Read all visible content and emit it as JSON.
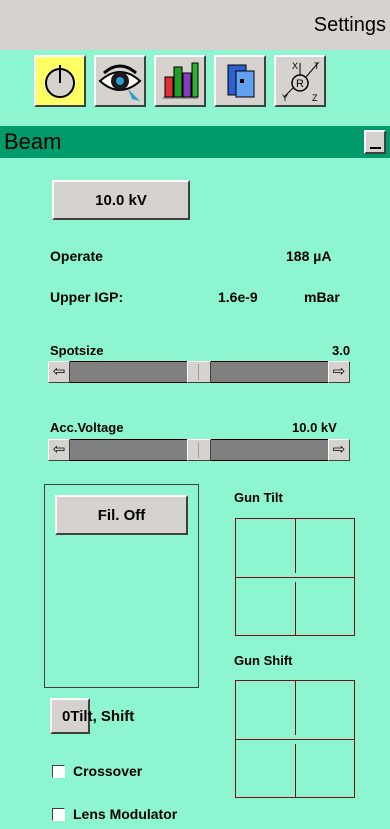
{
  "window": {
    "title": "Settings"
  },
  "toolbar": {
    "icons": [
      "knob-icon",
      "eye-icon",
      "bar-chart-icon",
      "panel-icon",
      "axes-icon"
    ]
  },
  "section": {
    "title": "Beam"
  },
  "beam": {
    "kv_button": "10.0 kV",
    "operate_label": "Operate",
    "operate_value": "188 µA",
    "igp_label": "Upper IGP:",
    "igp_value": "1.6e-9",
    "igp_unit": "mBar",
    "spotsize_label": "Spotsize",
    "spotsize_value": "3.0",
    "spotsize_level": 0.5,
    "acc_label": "Acc.Voltage",
    "acc_value": "10.0 kV",
    "acc_level": 0.5,
    "fil_button": "Fil. Off",
    "gun_tilt_label": "Gun Tilt",
    "gun_shift_label": "Gun Shift",
    "tilt_shift_button": "0Tilt, Shift",
    "crossover_label": "Crossover",
    "lens_modulator_label": "Lens Modulator"
  },
  "colors": {
    "panel_bg": "#8ef5d1",
    "header_bg": "#009a6b",
    "pad_lines": "#7a0f0f"
  }
}
